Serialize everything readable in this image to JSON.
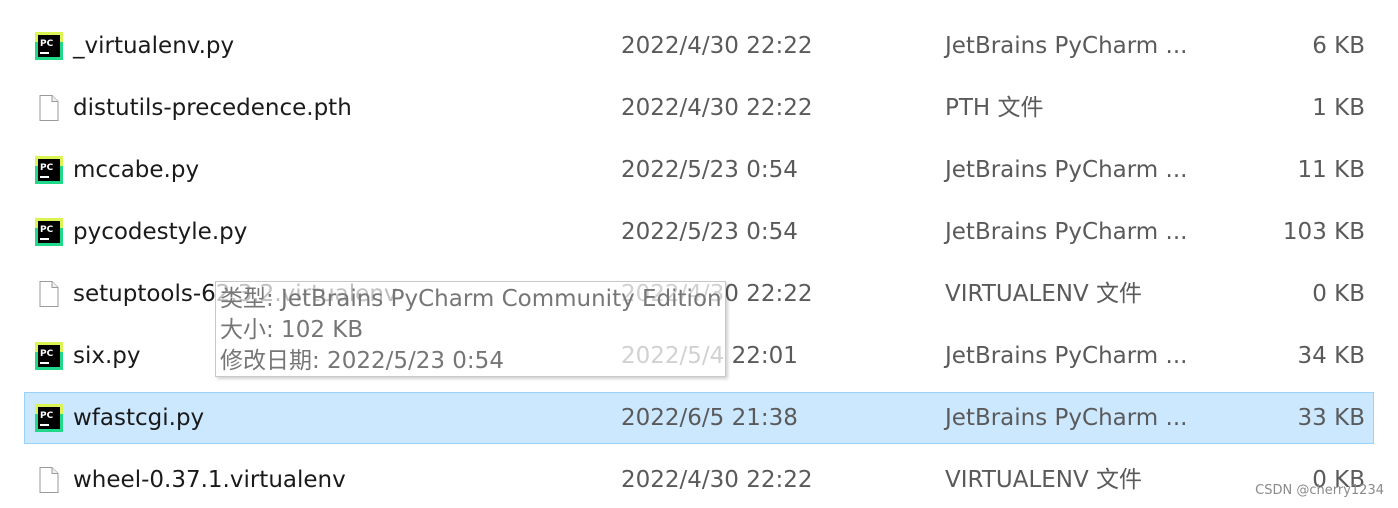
{
  "files": [
    {
      "name": "_virtualenv.py",
      "date": "2022/4/30 22:22",
      "type": "JetBrains PyCharm ...",
      "size": "6 KB",
      "icon": "pycharm-file-icon"
    },
    {
      "name": "distutils-precedence.pth",
      "date": "2022/4/30 22:22",
      "type": "PTH 文件",
      "size": "1 KB",
      "icon": "blank-file-icon"
    },
    {
      "name": "mccabe.py",
      "date": "2022/5/23 0:54",
      "type": "JetBrains PyCharm ...",
      "size": "11 KB",
      "icon": "pycharm-file-icon"
    },
    {
      "name": "pycodestyle.py",
      "date": "2022/5/23 0:54",
      "type": "JetBrains PyCharm ...",
      "size": "103 KB",
      "icon": "pycharm-file-icon"
    },
    {
      "name": "setuptools-62.3.2.virtualenv",
      "date": "2022/4/30 22:22",
      "type": "VIRTUALENV 文件",
      "size": "0 KB",
      "icon": "blank-file-icon"
    },
    {
      "name": "six.py",
      "date": "2022/5/4 22:01",
      "type": "JetBrains PyCharm ...",
      "size": "34 KB",
      "icon": "pycharm-file-icon"
    },
    {
      "name": "wfastcgi.py",
      "date": "2022/6/5 21:38",
      "type": "JetBrains PyCharm ...",
      "size": "33 KB",
      "icon": "pycharm-file-icon",
      "selected": true
    },
    {
      "name": "wheel-0.37.1.virtualenv",
      "date": "2022/4/30 22:22",
      "type": "VIRTUALENV 文件",
      "size": "0 KB",
      "icon": "blank-file-icon"
    }
  ],
  "tooltip": {
    "type_line": "类型: JetBrains PyCharm Community Edition",
    "size_line": "大小: 102 KB",
    "modified_line": "修改日期: 2022/5/23 0:54"
  },
  "watermark": "CSDN @cherry1234",
  "colors": {
    "selection_bg": "#cce8ff",
    "selection_border": "#99d1ff",
    "pycharm_green": "#21d789",
    "pycharm_yellow": "#fcf84a"
  }
}
